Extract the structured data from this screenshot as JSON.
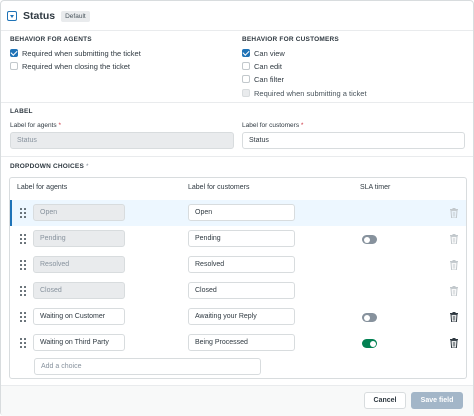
{
  "header": {
    "title": "Status",
    "badge": "Default"
  },
  "behavior_agents": {
    "title": "BEHAVIOR FOR AGENTS",
    "options": [
      {
        "label": "Required when submitting the ticket",
        "checked": true,
        "disabled": false
      },
      {
        "label": "Required when closing the ticket",
        "checked": false,
        "disabled": false
      }
    ]
  },
  "behavior_customers": {
    "title": "BEHAVIOR FOR CUSTOMERS",
    "options": [
      {
        "label": "Can view",
        "checked": true,
        "disabled": false
      },
      {
        "label": "Can edit",
        "checked": false,
        "disabled": false
      },
      {
        "label": "Can filter",
        "checked": false,
        "disabled": false
      },
      {
        "label": "Required when submitting a ticket",
        "checked": false,
        "disabled": true
      }
    ]
  },
  "label_section": {
    "title": "LABEL",
    "agents_label": "Label for agents",
    "agents_value": "Status",
    "customers_label": "Label for customers",
    "customers_value": "Status",
    "required_mark": "*"
  },
  "dropdown": {
    "title": "DROPDOWN CHOICES",
    "title_mark": "*",
    "headers": {
      "agents": "Label for agents",
      "customers": "Label for customers",
      "sla": "SLA timer"
    },
    "rows": [
      {
        "agent": "Open",
        "customer": "Open",
        "agent_editable": false,
        "sla": null,
        "deletable": false,
        "active": true
      },
      {
        "agent": "Pending",
        "customer": "Pending",
        "agent_editable": false,
        "sla": "off",
        "deletable": false,
        "active": false
      },
      {
        "agent": "Resolved",
        "customer": "Resolved",
        "agent_editable": false,
        "sla": null,
        "deletable": false,
        "active": false
      },
      {
        "agent": "Closed",
        "customer": "Closed",
        "agent_editable": false,
        "sla": null,
        "deletable": false,
        "active": false
      },
      {
        "agent": "Waiting on Customer",
        "customer": "Awaiting your Reply",
        "agent_editable": true,
        "sla": "off",
        "deletable": true,
        "active": false
      },
      {
        "agent": "Waiting on Third Party",
        "customer": "Being Processed",
        "agent_editable": true,
        "sla": "on",
        "deletable": true,
        "active": false
      }
    ],
    "add_placeholder": "Add a choice"
  },
  "footer": {
    "cancel_label": "Cancel",
    "save_label": "Save field"
  },
  "colors": {
    "accent": "#1f73b7",
    "toggle_on": "#038153",
    "save_disabled": "#a3b6c8"
  }
}
